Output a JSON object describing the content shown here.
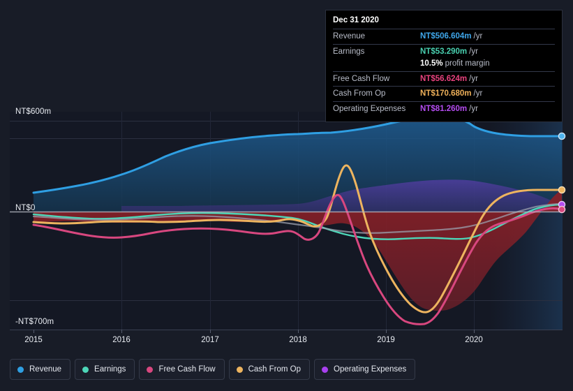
{
  "tooltip": {
    "date": "Dec 31 2020",
    "rows": [
      {
        "key": "Revenue",
        "value": "NT$506.604m",
        "unit": "/yr",
        "color": "#3fa7ea"
      },
      {
        "key": "Earnings",
        "value": "NT$53.290m",
        "unit": "/yr",
        "color": "#49d0b0"
      },
      {
        "key": "",
        "value": "10.5%",
        "unit": "profit margin",
        "color": "#ffffff"
      },
      {
        "key": "Free Cash Flow",
        "value": "NT$56.624m",
        "unit": "/yr",
        "color": "#e8427e"
      },
      {
        "key": "Cash From Op",
        "value": "NT$170.680m",
        "unit": "/yr",
        "color": "#eeb05a"
      },
      {
        "key": "Operating Expenses",
        "value": "NT$81.260m",
        "unit": "/yr",
        "color": "#b44cf0"
      }
    ]
  },
  "legend": {
    "items": [
      {
        "label": "Revenue",
        "color": "#2f9fe3"
      },
      {
        "label": "Earnings",
        "color": "#4dd6b8"
      },
      {
        "label": "Free Cash Flow",
        "color": "#d8477f"
      },
      {
        "label": "Cash From Op",
        "color": "#edb45f"
      },
      {
        "label": "Operating Expenses",
        "color": "#a840ef"
      }
    ]
  },
  "chart_data": {
    "type": "area",
    "title": "",
    "xlabel": "",
    "ylabel": "",
    "currency": "NT$",
    "units": "m",
    "grid": true,
    "legend_position": "bottom",
    "y_axis": {
      "ticks": [
        {
          "label": "NT$600m",
          "value": 600
        },
        {
          "label": "NT$0",
          "value": 0
        },
        {
          "label": "-NT$700m",
          "value": -700
        }
      ],
      "ylim": [
        -700,
        600
      ]
    },
    "x_axis": {
      "tick_labels": [
        "2015",
        "2016",
        "2017",
        "2018",
        "2019",
        "2020"
      ],
      "xlim": [
        "2015",
        "2020.75"
      ]
    },
    "series": [
      {
        "name": "Revenue",
        "color": "#2f9fe3",
        "x": [
          2015.0,
          2015.5,
          2016.0,
          2016.5,
          2017.0,
          2017.5,
          2018.0,
          2018.3,
          2018.7,
          2019.0,
          2019.5,
          2020.0,
          2020.25,
          2020.5,
          2020.75
        ],
        "values": [
          120,
          135,
          160,
          215,
          262,
          300,
          312,
          318,
          322,
          345,
          405,
          455,
          527,
          508,
          506.604
        ]
      },
      {
        "name": "Earnings",
        "color": "#4dd6b8",
        "x": [
          2015.0,
          2015.5,
          2016.0,
          2016.5,
          2017.0,
          2017.5,
          2018.0,
          2018.3,
          2018.7,
          2019.0,
          2019.5,
          2020.0,
          2020.4,
          2020.75
        ],
        "values": [
          -30,
          -38,
          -48,
          -30,
          -10,
          -16,
          -22,
          -30,
          -52,
          -76,
          -80,
          -74,
          -64,
          53.29
        ]
      },
      {
        "name": "Free Cash Flow",
        "color": "#d8477f",
        "x": [
          2015.0,
          2015.3,
          2015.8,
          2016.2,
          2016.7,
          2017.2,
          2017.6,
          2018.0,
          2018.2,
          2018.45,
          2018.7,
          2019.0,
          2019.3,
          2019.46,
          2019.7,
          2020.0,
          2020.35,
          2020.6,
          2020.75
        ],
        "values": [
          -95,
          -110,
          -145,
          -130,
          -100,
          -78,
          -70,
          -130,
          -55,
          35,
          -60,
          -310,
          -560,
          -700,
          -620,
          -420,
          -265,
          -90,
          56.624
        ]
      },
      {
        "name": "Cash From Op",
        "color": "#edb45f",
        "x": [
          2015.0,
          2015.3,
          2015.8,
          2016.2,
          2016.7,
          2017.2,
          2017.6,
          2018.0,
          2018.2,
          2018.45,
          2018.7,
          2019.0,
          2019.3,
          2019.47,
          2019.7,
          2020.0,
          2020.3,
          2020.55,
          2020.75
        ],
        "values": [
          -72,
          -82,
          -110,
          -92,
          -60,
          -40,
          -36,
          -110,
          20,
          132,
          10,
          -250,
          -490,
          -615,
          -530,
          -320,
          -110,
          120,
          170.68
        ]
      },
      {
        "name": "Operating Expenses",
        "color": "#a840ef",
        "x": [
          2016.0,
          2016.5,
          2017.0,
          2017.5,
          2018.0,
          2018.25,
          2018.6,
          2019.0,
          2019.4,
          2019.8,
          2020.1,
          2020.4,
          2020.75
        ],
        "values": [
          23,
          23,
          24,
          24,
          26,
          40,
          70,
          98,
          118,
          128,
          125,
          112,
          81.26
        ]
      }
    ]
  }
}
